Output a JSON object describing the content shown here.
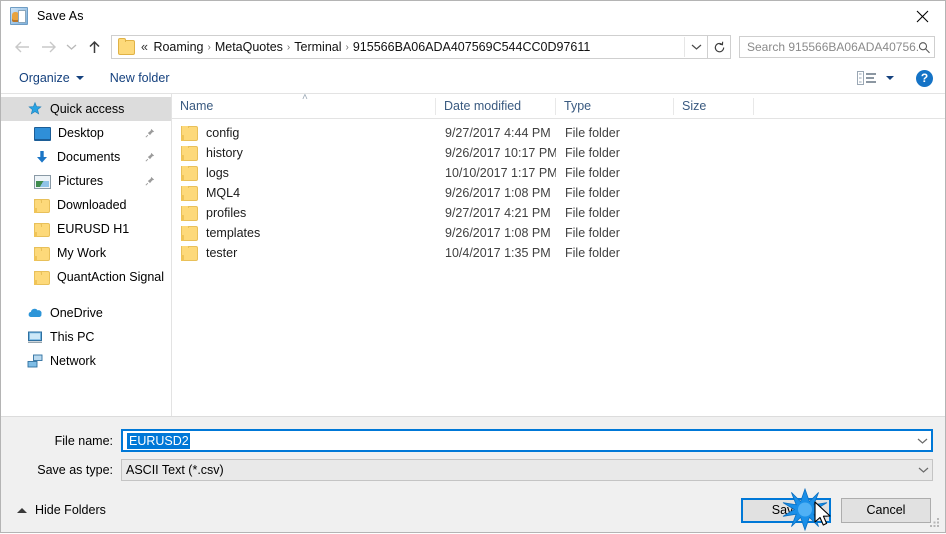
{
  "window": {
    "title": "Save As",
    "app_icon": "save-as-app-icon",
    "close_icon": "close-icon"
  },
  "nav": {
    "back_icon": "back-arrow-icon",
    "forward_icon": "forward-arrow-icon",
    "recent_icon": "chevron-down-icon",
    "up_icon": "up-arrow-icon",
    "refresh_icon": "refresh-icon",
    "breadcrumb_overflow": "«",
    "breadcrumb_separator": "›",
    "breadcrumbs": [
      "Roaming",
      "MetaQuotes",
      "Terminal",
      "915566BA06ADA407569C544CC0D97611"
    ],
    "address_dropdown_icon": "chevron-down-icon"
  },
  "search": {
    "placeholder": "Search 915566BA06ADA40756...",
    "icon": "search-icon"
  },
  "toolbar": {
    "organize_label": "Organize",
    "new_folder_label": "New folder",
    "view_icon": "view-options-icon",
    "help_label": "?",
    "help_icon": "help-icon"
  },
  "sidebar": {
    "items": [
      {
        "label": "Quick access",
        "icon": "star-icon",
        "selected": true,
        "indent": false,
        "pinned": false
      },
      {
        "label": "Desktop",
        "icon": "desktop-icon",
        "selected": false,
        "indent": true,
        "pinned": true
      },
      {
        "label": "Documents",
        "icon": "documents-download-icon",
        "selected": false,
        "indent": true,
        "pinned": true
      },
      {
        "label": "Pictures",
        "icon": "pictures-icon",
        "selected": false,
        "indent": true,
        "pinned": true
      },
      {
        "label": "Downloaded",
        "icon": "folder-icon",
        "selected": false,
        "indent": true,
        "pinned": false
      },
      {
        "label": "EURUSD H1",
        "icon": "folder-icon",
        "selected": false,
        "indent": true,
        "pinned": false
      },
      {
        "label": "My Work",
        "icon": "folder-icon",
        "selected": false,
        "indent": true,
        "pinned": false
      },
      {
        "label": "QuantAction Signal",
        "icon": "folder-icon",
        "selected": false,
        "indent": true,
        "pinned": false
      },
      {
        "label": "OneDrive",
        "icon": "onedrive-icon",
        "selected": false,
        "indent": false,
        "pinned": false
      },
      {
        "label": "This PC",
        "icon": "this-pc-icon",
        "selected": false,
        "indent": false,
        "pinned": false
      },
      {
        "label": "Network",
        "icon": "network-icon",
        "selected": false,
        "indent": false,
        "pinned": false
      }
    ]
  },
  "filelist": {
    "columns": [
      "Name",
      "Date modified",
      "Type",
      "Size"
    ],
    "sort_indicator": "˄",
    "rows": [
      {
        "name": "config",
        "date": "9/27/2017 4:44 PM",
        "type": "File folder",
        "size": "",
        "icon": "folder-icon"
      },
      {
        "name": "history",
        "date": "9/26/2017 10:17 PM",
        "type": "File folder",
        "size": "",
        "icon": "folder-icon"
      },
      {
        "name": "logs",
        "date": "10/10/2017 1:17 PM",
        "type": "File folder",
        "size": "",
        "icon": "folder-icon"
      },
      {
        "name": "MQL4",
        "date": "9/26/2017 1:08 PM",
        "type": "File folder",
        "size": "",
        "icon": "folder-icon"
      },
      {
        "name": "profiles",
        "date": "9/27/2017 4:21 PM",
        "type": "File folder",
        "size": "",
        "icon": "folder-icon"
      },
      {
        "name": "templates",
        "date": "9/26/2017 1:08 PM",
        "type": "File folder",
        "size": "",
        "icon": "folder-icon"
      },
      {
        "name": "tester",
        "date": "10/4/2017 1:35 PM",
        "type": "File folder",
        "size": "",
        "icon": "folder-icon"
      }
    ]
  },
  "form": {
    "file_name_label": "File name:",
    "file_name_value": "EURUSD2",
    "save_as_type_label": "Save as type:",
    "save_as_type_value": "ASCII Text (*.csv)",
    "dropdown_icon": "chevron-down-icon"
  },
  "footer": {
    "hide_folders_label": "Hide Folders",
    "hide_folders_icon": "chevron-up-icon",
    "save_label": "Save",
    "cancel_label": "Cancel",
    "resize_grip_icon": "resize-grip-icon",
    "click_burst_icon": "click-burst-icon",
    "cursor_icon": "mouse-pointer-icon"
  },
  "colors": {
    "accent": "#0078d7",
    "selection": "#0078d7",
    "folder": "#fdd97a",
    "header_text": "#3a5a80",
    "link": "#15417e"
  }
}
